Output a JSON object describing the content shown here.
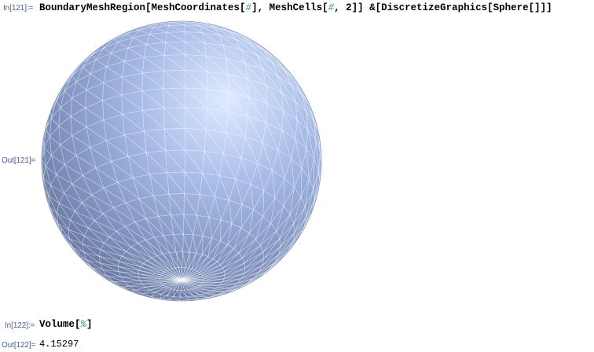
{
  "cells": {
    "in121": {
      "label": "In[121]:=",
      "code_parts": {
        "p1": "BoundaryMeshRegion[MeshCoordinates[",
        "slot1": "#",
        "p2": "], MeshCells[",
        "slot2": "#",
        "p3": ", 2]] &[DiscretizeGraphics[Sphere[]]]"
      }
    },
    "out121": {
      "label": "Out[121]=",
      "graphic_icon": "triangulated-sphere-graphic"
    },
    "in122": {
      "label": "In[122]:=",
      "code_parts": {
        "p1": "Volume[",
        "slot1": "%",
        "p2": "]"
      }
    },
    "out122": {
      "label": "Out[122]=",
      "value": "4.15297"
    }
  },
  "colors": {
    "label": "#4b5f94",
    "slot": "#3c8c6e",
    "sphere_light": "#dce8ff",
    "sphere_mid": "#93a7d3",
    "sphere_dark": "#5f6f9a",
    "mesh_lines": "#ffffff"
  }
}
